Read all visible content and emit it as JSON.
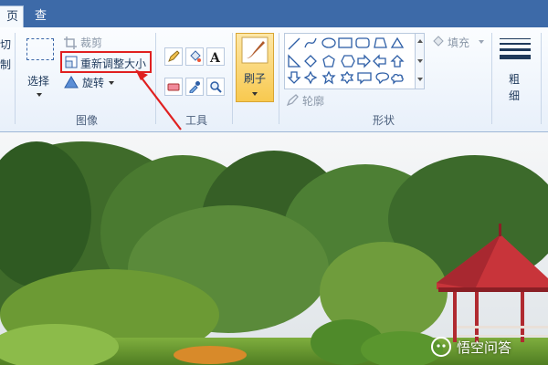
{
  "tabs": [
    {
      "label": "页",
      "active": true
    },
    {
      "label": "查看",
      "active": false
    }
  ],
  "clipboard": {
    "cut_glyph": "切",
    "copy_glyph": "制"
  },
  "image_group": {
    "label": "图像",
    "select_label": "选择",
    "crop_label": "裁剪",
    "resize_label": "重新调整大小",
    "rotate_label": "旋转"
  },
  "tools_group": {
    "label": "工具"
  },
  "brush": {
    "label": "刷子"
  },
  "shapes_group": {
    "label": "形状",
    "outline_label": "轮廓",
    "fill_label": "填充"
  },
  "size": {
    "label_line1": "粗",
    "label_line2": "细"
  },
  "watermark": {
    "text": "悟空问答"
  },
  "colors": {
    "accent_red": "#e02020",
    "tab_bar": "#3d6aa8",
    "brush_highlight": "#f8c94f"
  }
}
